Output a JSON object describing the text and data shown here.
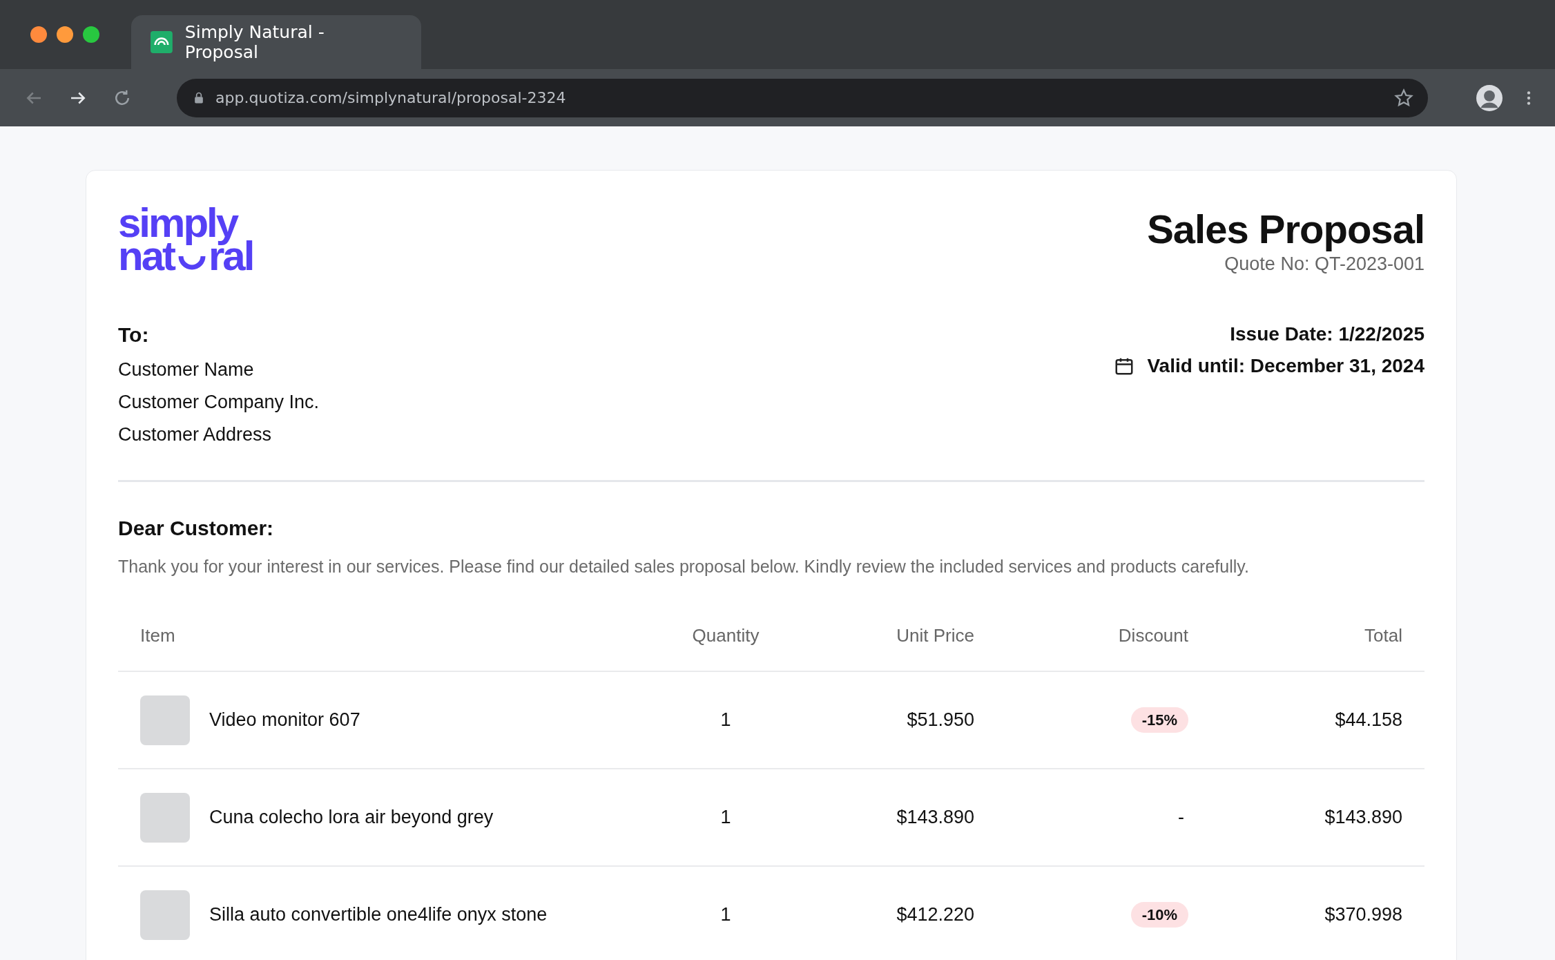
{
  "browser": {
    "tab_title": "Simply Natural - Proposal",
    "url": "app.quotiza.com/simplynatural/proposal-2324"
  },
  "header": {
    "logo_line_1": "simply",
    "logo_line_2_start": "nat",
    "logo_line_2_end": "ral",
    "title": "Sales Proposal",
    "quote_no": "Quote No: QT-2023-001"
  },
  "recipient": {
    "label": "To:",
    "lines": [
      "Customer Name",
      "Customer Company Inc.",
      "Customer Address"
    ]
  },
  "dates": {
    "issue": "Issue Date: 1/22/2025",
    "valid_until": "Valid until: December 31, 2024"
  },
  "greeting": "Dear Customer:",
  "intro": "Thank you for your interest in our services. Please find our detailed sales proposal below. Kindly review the included services and products carefully.",
  "table": {
    "columns": [
      "Item",
      "Quantity",
      "Unit Price",
      "Discount",
      "Total"
    ],
    "rows": [
      {
        "item": "Video monitor 607",
        "quantity": "1",
        "unit_price": "$51.950",
        "discount": {
          "kind": "badge",
          "text": "-15%"
        },
        "total": "$44.158"
      },
      {
        "item": "Cuna colecho lora air beyond grey",
        "quantity": "1",
        "unit_price": "$143.890",
        "discount": {
          "kind": "plain",
          "text": "-"
        },
        "total": "$143.890"
      },
      {
        "item": "Silla auto convertible one4life onyx stone",
        "quantity": "1",
        "unit_price": "$412.220",
        "discount": {
          "kind": "badge",
          "text": "-10%"
        },
        "total": "$370.998"
      }
    ]
  }
}
